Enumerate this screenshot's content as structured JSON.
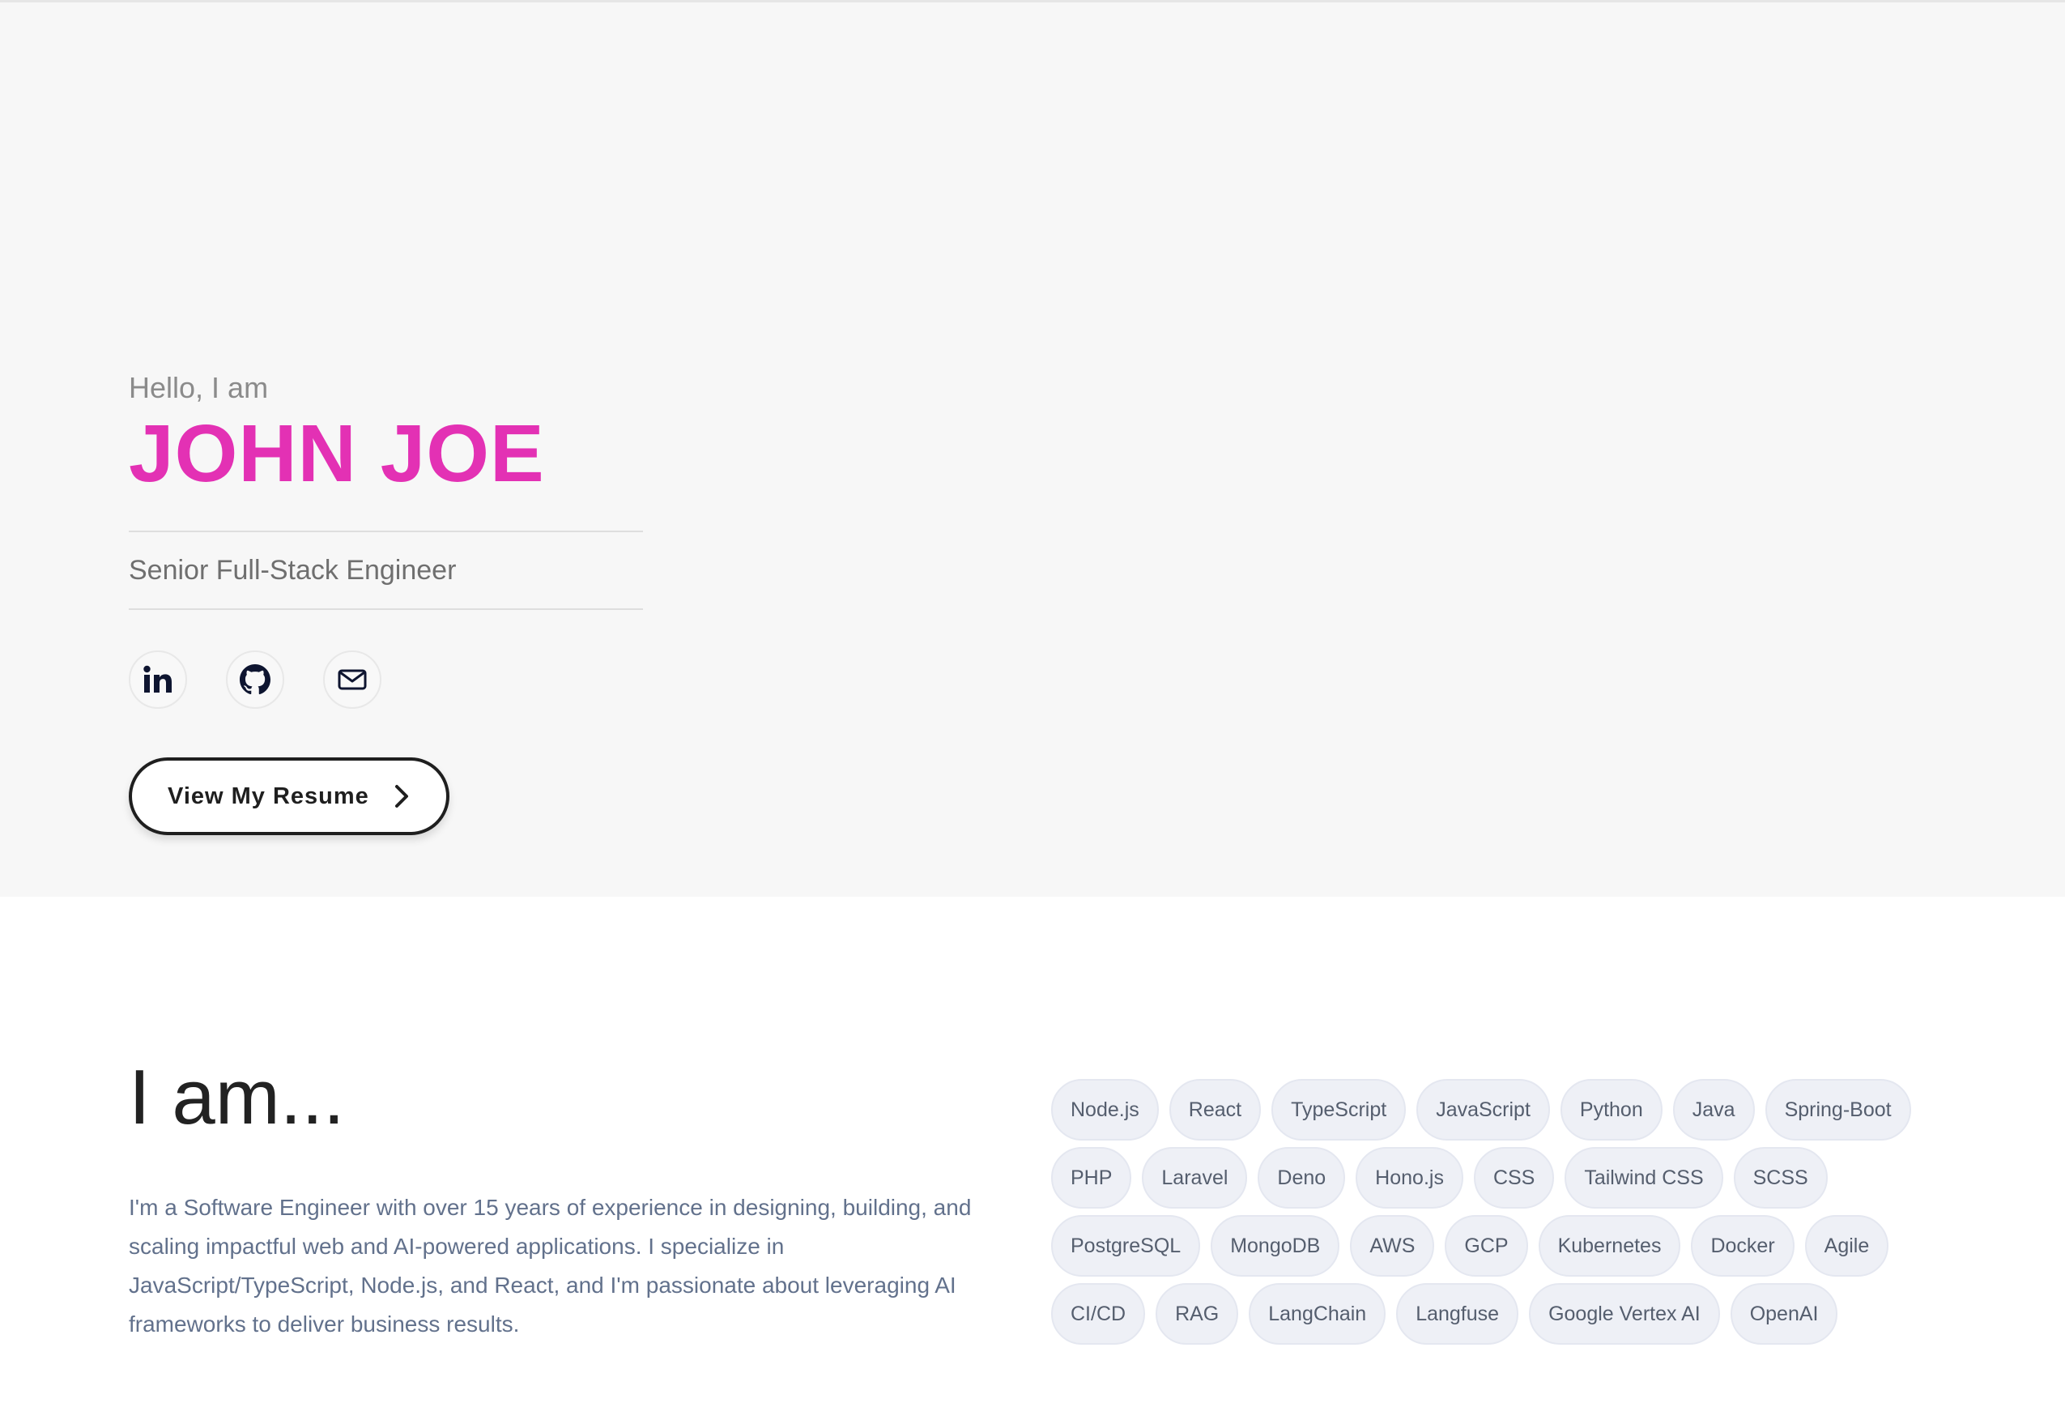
{
  "hero": {
    "greeting": "Hello, I am",
    "name": "JOHN JOE",
    "title": "Senior Full-Stack Engineer",
    "socials": [
      {
        "name": "linkedin",
        "icon": "linkedin-icon"
      },
      {
        "name": "github",
        "icon": "github-icon"
      },
      {
        "name": "email",
        "icon": "mail-icon"
      }
    ],
    "resume_button": "View My Resume",
    "accent_color": "#e331b4"
  },
  "about": {
    "heading": "I am...",
    "text": "I'm a Software Engineer with over 15 years of experience in designing, building, and scaling impactful web and AI-powered applications. I specialize in JavaScript/TypeScript, Node.js, and React, and I'm passionate about leveraging AI frameworks to deliver business results.",
    "skills": [
      [
        "Node.js",
        "React",
        "TypeScript",
        "JavaScript",
        "Python",
        "Java",
        "Spring-Boot"
      ],
      [
        "PHP",
        "Laravel",
        "Deno",
        "Hono.js",
        "CSS",
        "Tailwind CSS",
        "SCSS"
      ],
      [
        "PostgreSQL",
        "MongoDB",
        "AWS",
        "GCP",
        "Kubernetes",
        "Docker",
        "Agile"
      ],
      [
        "CI/CD",
        "RAG",
        "LangChain",
        "Langfuse",
        "Google Vertex AI",
        "OpenAI"
      ]
    ]
  }
}
